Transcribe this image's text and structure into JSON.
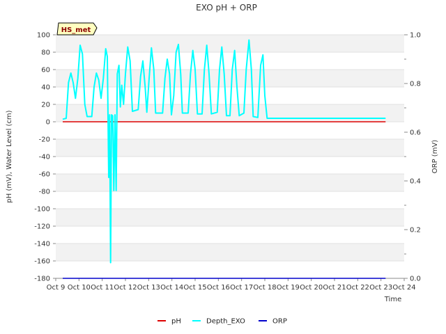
{
  "chart_data": {
    "type": "line",
    "title": "EXO pH + ORP",
    "xlabel": "Time",
    "ylabel": "pH (mV), Water Level (cm)",
    "y2label": "ORP (mV)",
    "badge": "HS_met",
    "x_ticks": [
      "Oct 9",
      "Oct 10",
      "Oct 11",
      "Oct 12",
      "Oct 13",
      "Oct 14",
      "Oct 15",
      "Oct 16",
      "Oct 17",
      "Oct 18",
      "Oct 19",
      "Oct 20",
      "Oct 21",
      "Oct 22",
      "Oct 23",
      "Oct 24"
    ],
    "y_ticks": [
      100,
      80,
      60,
      40,
      20,
      0,
      -20,
      -40,
      -60,
      -80,
      -100,
      -120,
      -140,
      -160,
      -180
    ],
    "y2_ticks": [
      "1.0",
      "0.8",
      "0.6",
      "0.4",
      "0.2",
      "0.0"
    ],
    "ylim": [
      -180,
      100
    ],
    "y2lim": [
      0,
      1
    ],
    "grid": "horizontal bands",
    "legend_position": "bottom-center",
    "series": [
      {
        "name": "pH",
        "color": "#dd0000",
        "axis": "left",
        "points": [
          [
            9.3,
            0
          ],
          [
            23.2,
            0
          ]
        ]
      },
      {
        "name": "Depth_EXO",
        "color": "#00ffff",
        "axis": "left",
        "points": [
          [
            9.3,
            3
          ],
          [
            9.45,
            4
          ],
          [
            9.55,
            45
          ],
          [
            9.65,
            56
          ],
          [
            9.75,
            45
          ],
          [
            9.85,
            27
          ],
          [
            9.95,
            50
          ],
          [
            10.05,
            88
          ],
          [
            10.15,
            78
          ],
          [
            10.25,
            20
          ],
          [
            10.35,
            6
          ],
          [
            10.55,
            6
          ],
          [
            10.65,
            40
          ],
          [
            10.75,
            56
          ],
          [
            10.85,
            48
          ],
          [
            10.95,
            27
          ],
          [
            11.05,
            50
          ],
          [
            11.15,
            84
          ],
          [
            11.22,
            75
          ],
          [
            11.28,
            -64
          ],
          [
            11.32,
            8
          ],
          [
            11.36,
            -162
          ],
          [
            11.4,
            8
          ],
          [
            11.45,
            7
          ],
          [
            11.5,
            -79
          ],
          [
            11.55,
            8
          ],
          [
            11.6,
            -79
          ],
          [
            11.65,
            55
          ],
          [
            11.72,
            65
          ],
          [
            11.78,
            17
          ],
          [
            11.84,
            42
          ],
          [
            11.92,
            20
          ],
          [
            12.0,
            55
          ],
          [
            12.1,
            86
          ],
          [
            12.2,
            70
          ],
          [
            12.3,
            12
          ],
          [
            12.55,
            14
          ],
          [
            12.65,
            52
          ],
          [
            12.75,
            70
          ],
          [
            12.85,
            40
          ],
          [
            12.92,
            11
          ],
          [
            13.02,
            50
          ],
          [
            13.12,
            85
          ],
          [
            13.22,
            60
          ],
          [
            13.3,
            10
          ],
          [
            13.6,
            10
          ],
          [
            13.7,
            50
          ],
          [
            13.8,
            72
          ],
          [
            13.9,
            55
          ],
          [
            13.98,
            8
          ],
          [
            14.08,
            30
          ],
          [
            14.18,
            80
          ],
          [
            14.28,
            89
          ],
          [
            14.38,
            55
          ],
          [
            14.45,
            10
          ],
          [
            14.7,
            10
          ],
          [
            14.8,
            55
          ],
          [
            14.9,
            82
          ],
          [
            15.0,
            60
          ],
          [
            15.1,
            9
          ],
          [
            15.3,
            9
          ],
          [
            15.4,
            60
          ],
          [
            15.5,
            88
          ],
          [
            15.6,
            55
          ],
          [
            15.7,
            9
          ],
          [
            15.95,
            11
          ],
          [
            16.05,
            60
          ],
          [
            16.15,
            86
          ],
          [
            16.25,
            55
          ],
          [
            16.35,
            7
          ],
          [
            16.5,
            7
          ],
          [
            16.6,
            60
          ],
          [
            16.7,
            82
          ],
          [
            16.8,
            40
          ],
          [
            16.9,
            7
          ],
          [
            17.1,
            10
          ],
          [
            17.2,
            60
          ],
          [
            17.32,
            94
          ],
          [
            17.42,
            60
          ],
          [
            17.5,
            6
          ],
          [
            17.7,
            5
          ],
          [
            17.82,
            65
          ],
          [
            17.92,
            77
          ],
          [
            18.0,
            30
          ],
          [
            18.1,
            4
          ],
          [
            23.2,
            4
          ]
        ]
      },
      {
        "name": "ORP",
        "color": "#0000cc",
        "axis": "right",
        "points": [
          [
            9.3,
            0
          ],
          [
            23.2,
            0
          ]
        ]
      }
    ]
  }
}
